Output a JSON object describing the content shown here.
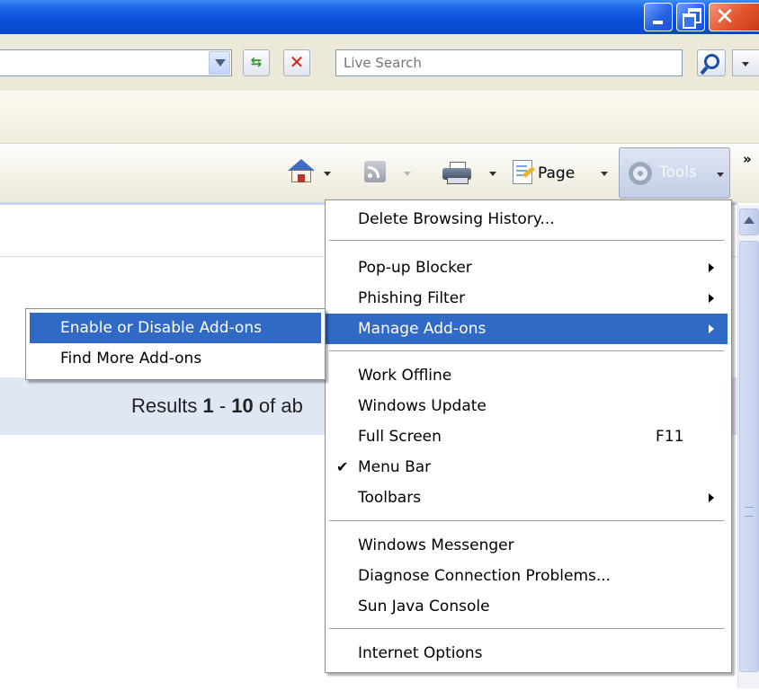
{
  "search": {
    "placeholder": "Live Search"
  },
  "commandbar": {
    "page_label": "Page",
    "tools_label": "Tools"
  },
  "content": {
    "results_prefix": "Results ",
    "results_from": "1",
    "results_sep": " - ",
    "results_to": "10",
    "results_suffix": " of ab"
  },
  "tools_menu": {
    "delete_history": "Delete Browsing History...",
    "popup_blocker": "Pop-up Blocker",
    "phishing_filter": "Phishing Filter",
    "manage_addons": "Manage Add-ons",
    "work_offline": "Work Offline",
    "windows_update": "Windows Update",
    "full_screen": "Full Screen",
    "full_screen_shortcut": "F11",
    "menu_bar": "Menu Bar",
    "toolbars": "Toolbars",
    "windows_messenger": "Windows Messenger",
    "diagnose": "Diagnose Connection Problems...",
    "java_console": "Sun Java Console",
    "internet_options": "Internet Options"
  },
  "addons_submenu": {
    "enable_disable": "Enable or Disable Add-ons",
    "find_more": "Find More Add-ons"
  },
  "colors": {
    "highlight": "#316ac5",
    "titlebar": "#0a4fd8",
    "toolbar": "#ece9d8"
  },
  "icons": [
    "minimize-icon",
    "maximize-icon",
    "close-icon",
    "refresh-icon",
    "stop-icon",
    "search-icon",
    "home-icon",
    "feeds-icon",
    "print-icon",
    "page-icon",
    "gear-icon",
    "checkmark-icon"
  ]
}
